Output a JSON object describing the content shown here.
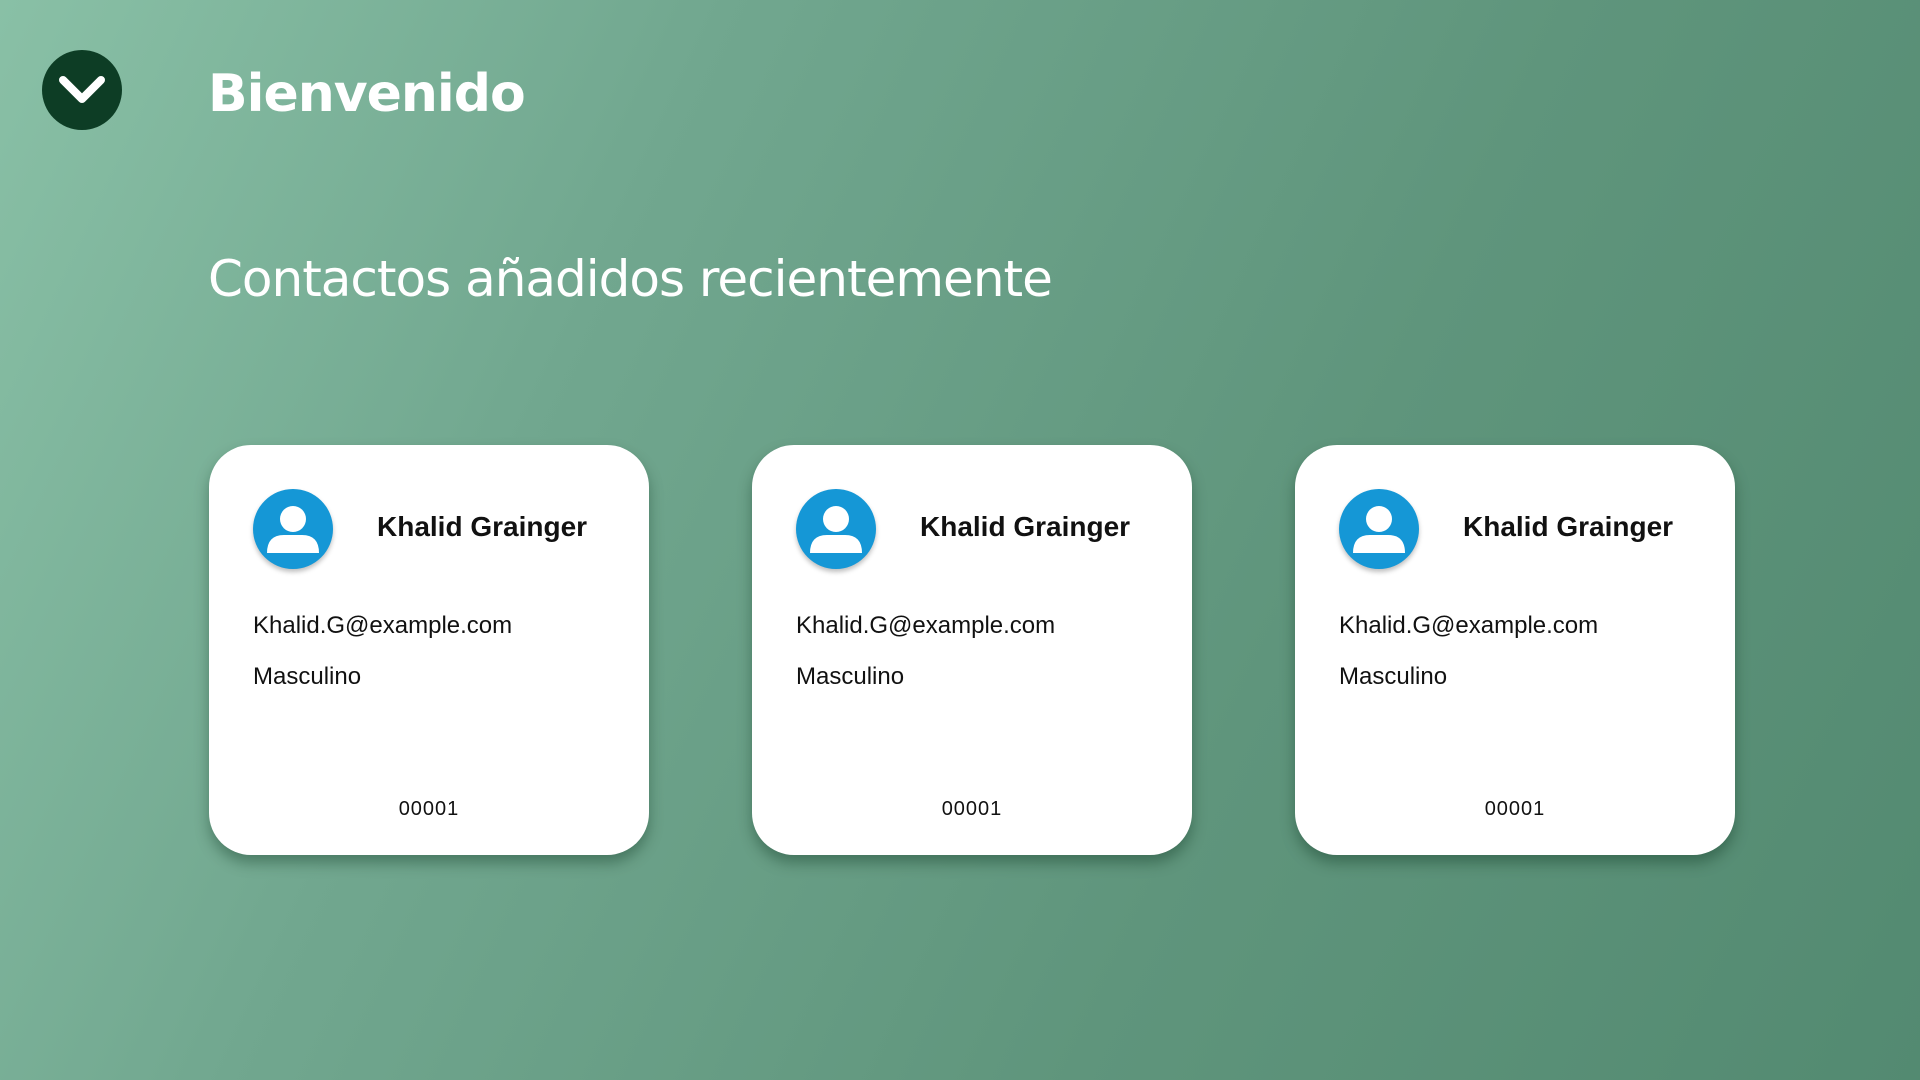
{
  "header": {
    "menu_icon": "chevron-down-icon",
    "title": "Bienvenido"
  },
  "section": {
    "title": "Contactos añadidos recientemente"
  },
  "colors": {
    "background_start": "#89c0a6",
    "background_end": "#538a71",
    "menu_button": "#0d3d25",
    "avatar": "#1597d6",
    "card": "#ffffff"
  },
  "contacts": [
    {
      "avatar_icon": "user-icon",
      "name": "Khalid Grainger",
      "email": "Khalid.G@example.com",
      "gender": "Masculino",
      "id": "00001"
    },
    {
      "avatar_icon": "user-icon",
      "name": "Khalid Grainger",
      "email": "Khalid.G@example.com",
      "gender": "Masculino",
      "id": "00001"
    },
    {
      "avatar_icon": "user-icon",
      "name": "Khalid Grainger",
      "email": "Khalid.G@example.com",
      "gender": "Masculino",
      "id": "00001"
    }
  ]
}
